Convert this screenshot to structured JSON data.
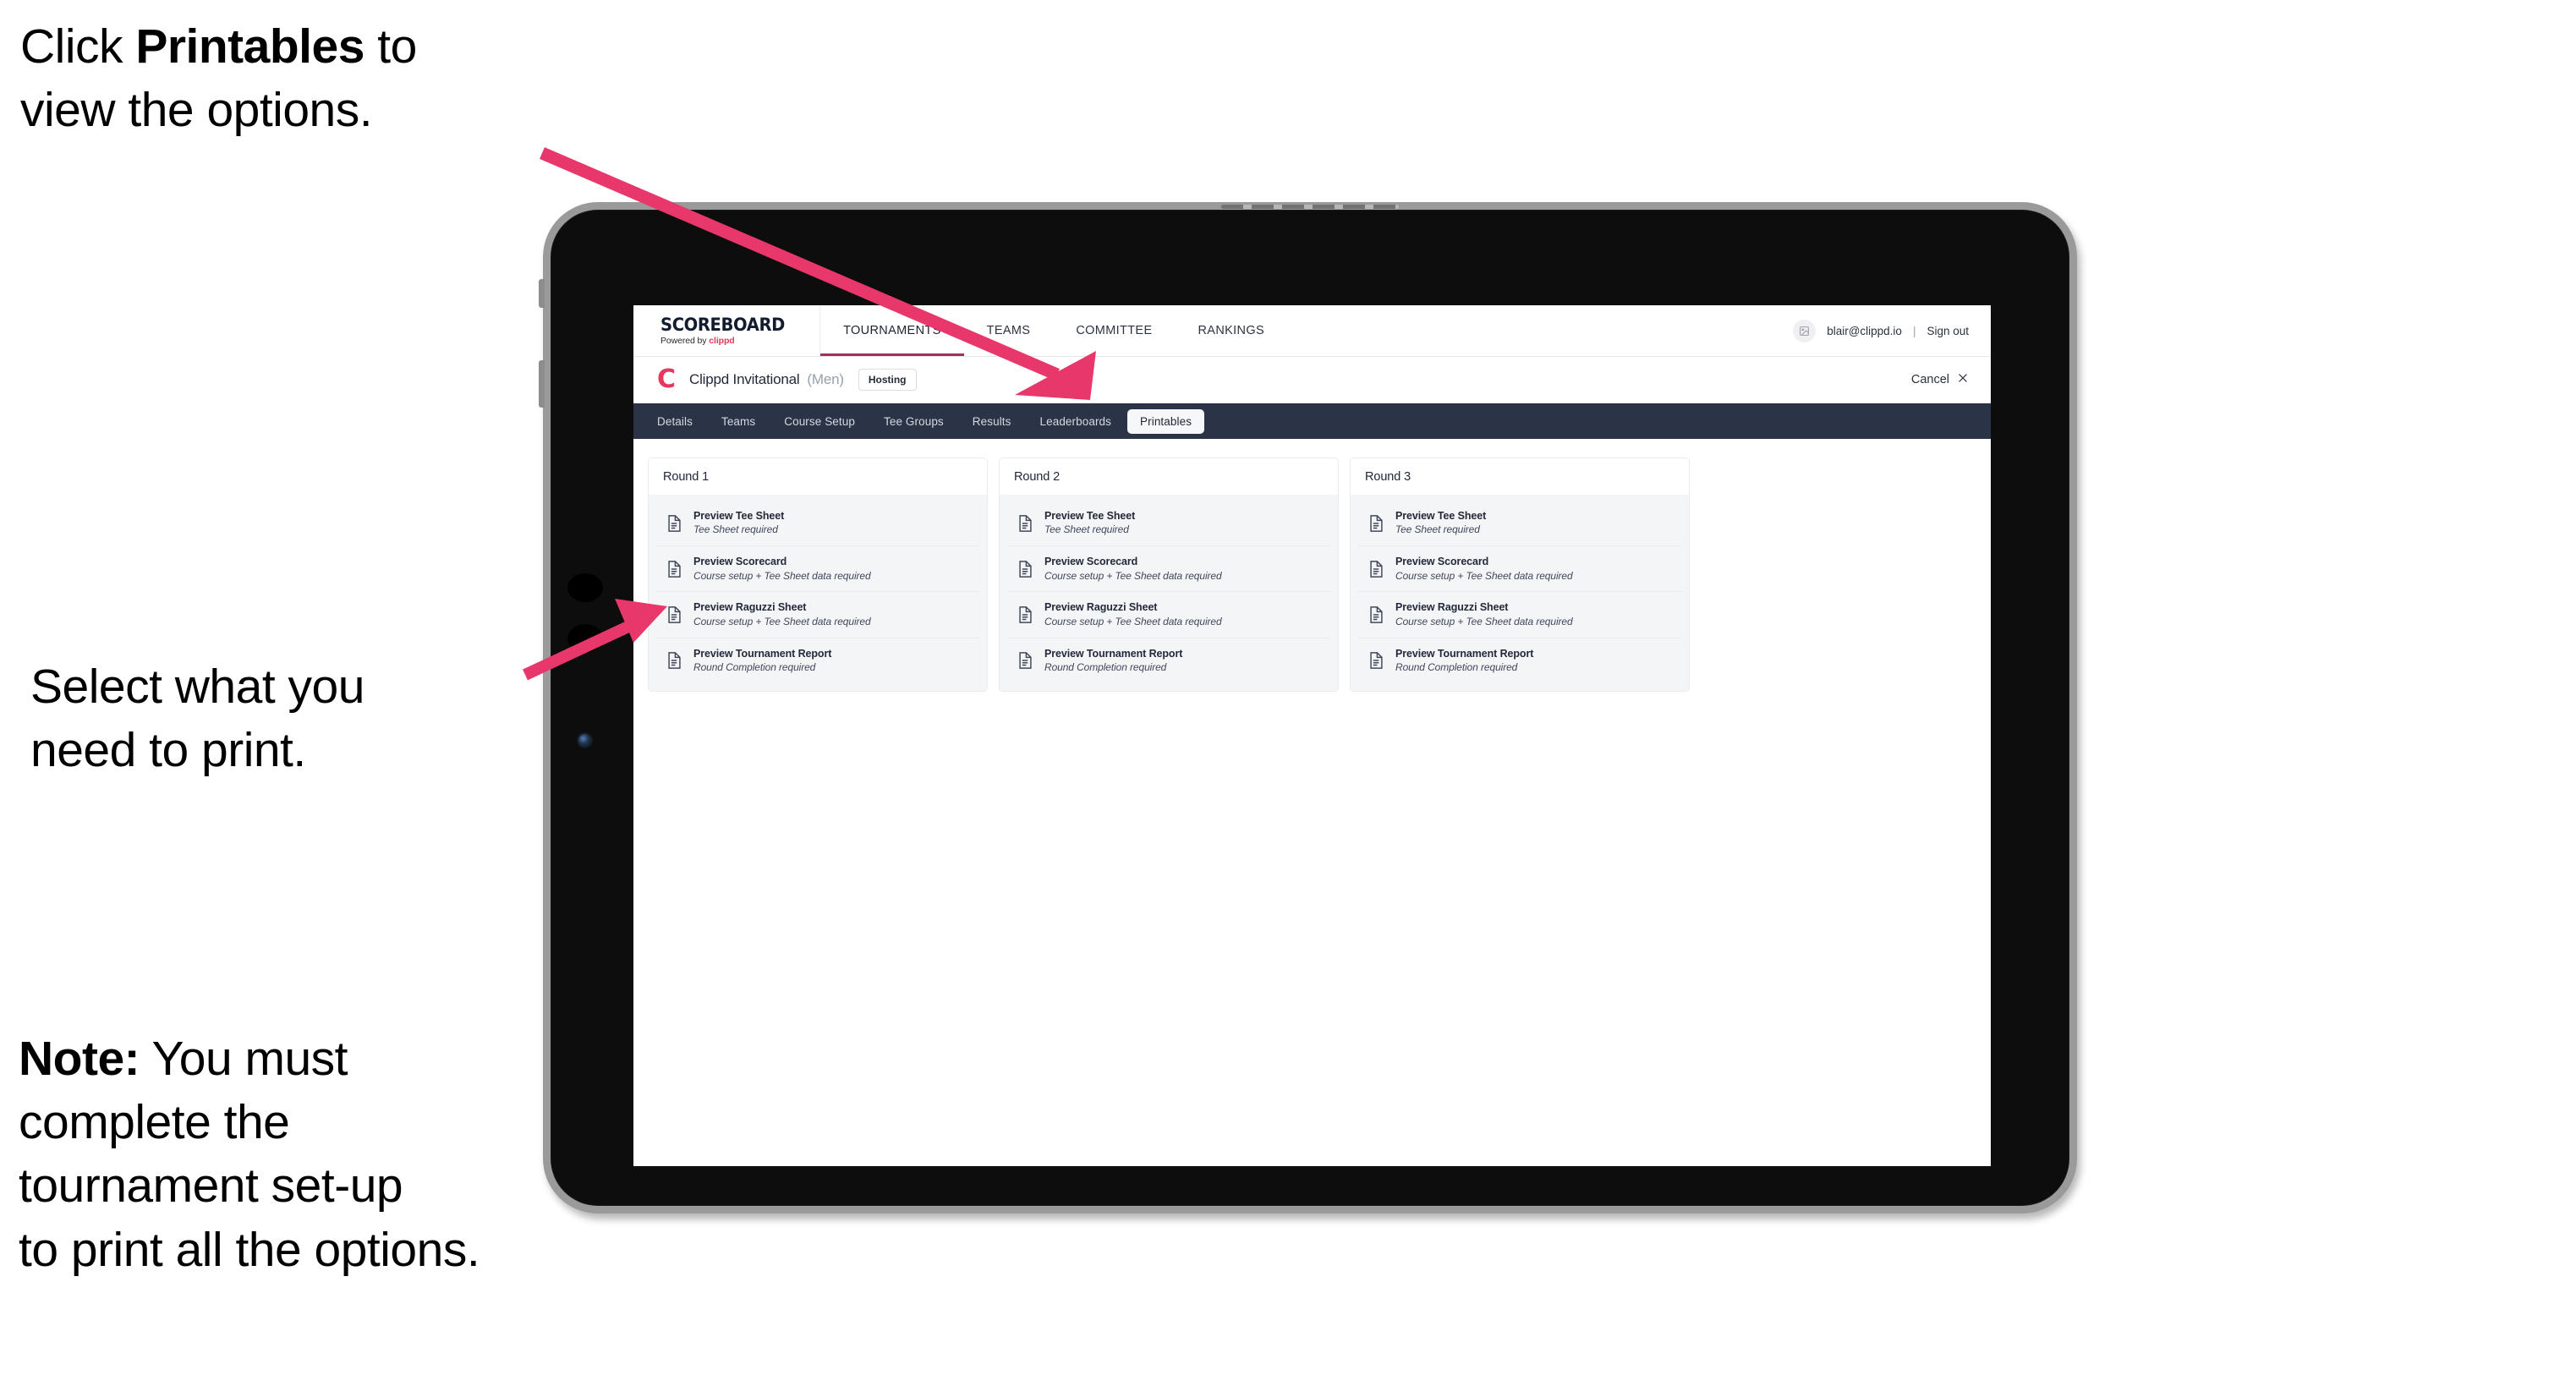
{
  "annotations": {
    "click_printables": {
      "prefix": "Click ",
      "bold": "Printables",
      "suffix": " to\nview the options."
    },
    "select_print": "Select what you\n need to print.",
    "note": {
      "bold": "Note:",
      "rest": " You must\ncomplete the\ntournament set-up\nto print all the options."
    }
  },
  "colors": {
    "accent_pink": "#e8365d",
    "arrow_pink": "#e8376a",
    "navbar_dark": "#2b3447",
    "tab_underline": "#a3305a"
  },
  "browser": {
    "topbar": {
      "brand_title": "SCOREBOARD",
      "brand_sub_prefix": "Powered by ",
      "brand_sub_accent": "clippd",
      "nav_items": [
        {
          "label": "TOURNAMENTS",
          "active": true
        },
        {
          "label": "TEAMS",
          "active": false
        },
        {
          "label": "COMMITTEE",
          "active": false
        },
        {
          "label": "RANKINGS",
          "active": false
        }
      ],
      "avatar_icon": "user-avatar-icon",
      "user_email": "blair@clippd.io",
      "separator": "|",
      "signout_label": "Sign out"
    },
    "tournament_header": {
      "logo_letter": "C",
      "name": "Clippd Invitational",
      "gender": "(Men)",
      "hosting_label": "Hosting",
      "cancel_label": "Cancel",
      "cancel_icon": "close-icon"
    },
    "tabs": [
      {
        "label": "Details",
        "selected": false
      },
      {
        "label": "Teams",
        "selected": false
      },
      {
        "label": "Course Setup",
        "selected": false
      },
      {
        "label": "Tee Groups",
        "selected": false
      },
      {
        "label": "Results",
        "selected": false
      },
      {
        "label": "Leaderboards",
        "selected": false
      },
      {
        "label": "Printables",
        "selected": true
      }
    ],
    "rounds": [
      {
        "title": "Round 1",
        "items": [
          {
            "title": "Preview Tee Sheet",
            "sub": "Tee Sheet required",
            "icon": "document-icon"
          },
          {
            "title": "Preview Scorecard",
            "sub": "Course setup + Tee Sheet data required",
            "icon": "document-icon"
          },
          {
            "title": "Preview Raguzzi Sheet",
            "sub": "Course setup + Tee Sheet data required",
            "icon": "document-icon"
          },
          {
            "title": "Preview Tournament Report",
            "sub": "Round Completion required",
            "icon": "document-icon"
          }
        ]
      },
      {
        "title": "Round 2",
        "items": [
          {
            "title": "Preview Tee Sheet",
            "sub": "Tee Sheet required",
            "icon": "document-icon"
          },
          {
            "title": "Preview Scorecard",
            "sub": "Course setup + Tee Sheet data required",
            "icon": "document-icon"
          },
          {
            "title": "Preview Raguzzi Sheet",
            "sub": "Course setup + Tee Sheet data required",
            "icon": "document-icon"
          },
          {
            "title": "Preview Tournament Report",
            "sub": "Round Completion required",
            "icon": "document-icon"
          }
        ]
      },
      {
        "title": "Round 3",
        "items": [
          {
            "title": "Preview Tee Sheet",
            "sub": "Tee Sheet required",
            "icon": "document-icon"
          },
          {
            "title": "Preview Scorecard",
            "sub": "Course setup + Tee Sheet data required",
            "icon": "document-icon"
          },
          {
            "title": "Preview Raguzzi Sheet",
            "sub": "Course setup + Tee Sheet data required",
            "icon": "document-icon"
          },
          {
            "title": "Preview Tournament Report",
            "sub": "Round Completion required",
            "icon": "document-icon"
          }
        ]
      }
    ]
  }
}
